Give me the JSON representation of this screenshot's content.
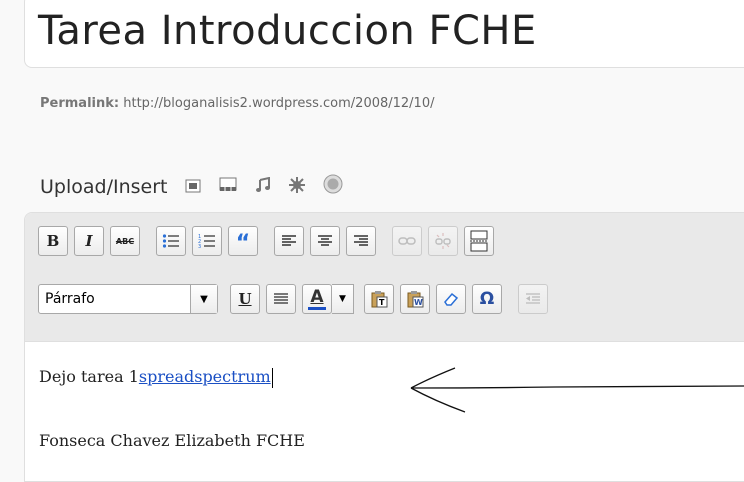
{
  "post": {
    "title": "Tarea Introduccion FCHE",
    "permalink_label": "Permalink:",
    "permalink_url": "http://bloganalisis2.wordpress.com/2008/12/10/"
  },
  "upload": {
    "label": "Upload/Insert",
    "icons": [
      "image-icon",
      "video-icon",
      "audio-icon",
      "media-icon",
      "gallery-icon"
    ]
  },
  "toolbar": {
    "row1": [
      "bold",
      "italic",
      "strikethrough",
      "unordered-list",
      "ordered-list",
      "blockquote",
      "align-left",
      "align-center",
      "align-right",
      "link",
      "unlink",
      "more-tag"
    ],
    "bold_label": "B",
    "italic_label": "I",
    "strike_label": "ABC",
    "quote_label": "“",
    "format_value": "Párrafo",
    "underline_label": "U",
    "color_label": "A",
    "omega_label": "Ω",
    "text_color": "#1a4fc4"
  },
  "content": {
    "line1_prefix": "Dejo tarea 1",
    "line1_link": "spreadspectrum",
    "line2": "Fonseca Chavez Elizabeth FCHE"
  }
}
